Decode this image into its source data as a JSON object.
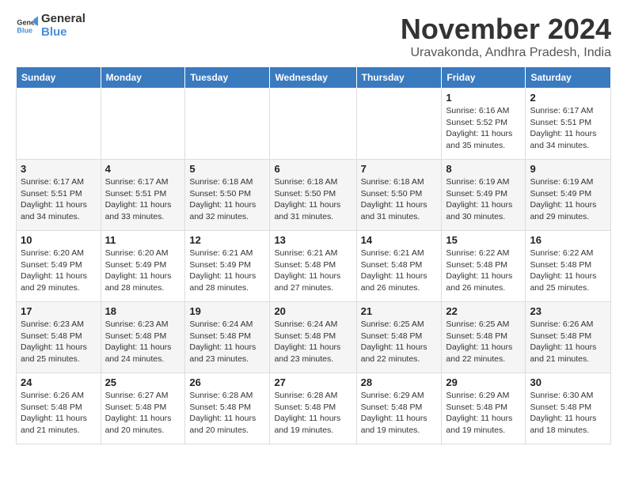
{
  "logo": {
    "text_general": "General",
    "text_blue": "Blue"
  },
  "header": {
    "month_title": "November 2024",
    "location": "Uravakonda, Andhra Pradesh, India"
  },
  "weekdays": [
    "Sunday",
    "Monday",
    "Tuesday",
    "Wednesday",
    "Thursday",
    "Friday",
    "Saturday"
  ],
  "weeks": [
    [
      {
        "day": "",
        "info": ""
      },
      {
        "day": "",
        "info": ""
      },
      {
        "day": "",
        "info": ""
      },
      {
        "day": "",
        "info": ""
      },
      {
        "day": "",
        "info": ""
      },
      {
        "day": "1",
        "info": "Sunrise: 6:16 AM\nSunset: 5:52 PM\nDaylight: 11 hours and 35 minutes."
      },
      {
        "day": "2",
        "info": "Sunrise: 6:17 AM\nSunset: 5:51 PM\nDaylight: 11 hours and 34 minutes."
      }
    ],
    [
      {
        "day": "3",
        "info": "Sunrise: 6:17 AM\nSunset: 5:51 PM\nDaylight: 11 hours and 34 minutes."
      },
      {
        "day": "4",
        "info": "Sunrise: 6:17 AM\nSunset: 5:51 PM\nDaylight: 11 hours and 33 minutes."
      },
      {
        "day": "5",
        "info": "Sunrise: 6:18 AM\nSunset: 5:50 PM\nDaylight: 11 hours and 32 minutes."
      },
      {
        "day": "6",
        "info": "Sunrise: 6:18 AM\nSunset: 5:50 PM\nDaylight: 11 hours and 31 minutes."
      },
      {
        "day": "7",
        "info": "Sunrise: 6:18 AM\nSunset: 5:50 PM\nDaylight: 11 hours and 31 minutes."
      },
      {
        "day": "8",
        "info": "Sunrise: 6:19 AM\nSunset: 5:49 PM\nDaylight: 11 hours and 30 minutes."
      },
      {
        "day": "9",
        "info": "Sunrise: 6:19 AM\nSunset: 5:49 PM\nDaylight: 11 hours and 29 minutes."
      }
    ],
    [
      {
        "day": "10",
        "info": "Sunrise: 6:20 AM\nSunset: 5:49 PM\nDaylight: 11 hours and 29 minutes."
      },
      {
        "day": "11",
        "info": "Sunrise: 6:20 AM\nSunset: 5:49 PM\nDaylight: 11 hours and 28 minutes."
      },
      {
        "day": "12",
        "info": "Sunrise: 6:21 AM\nSunset: 5:49 PM\nDaylight: 11 hours and 28 minutes."
      },
      {
        "day": "13",
        "info": "Sunrise: 6:21 AM\nSunset: 5:48 PM\nDaylight: 11 hours and 27 minutes."
      },
      {
        "day": "14",
        "info": "Sunrise: 6:21 AM\nSunset: 5:48 PM\nDaylight: 11 hours and 26 minutes."
      },
      {
        "day": "15",
        "info": "Sunrise: 6:22 AM\nSunset: 5:48 PM\nDaylight: 11 hours and 26 minutes."
      },
      {
        "day": "16",
        "info": "Sunrise: 6:22 AM\nSunset: 5:48 PM\nDaylight: 11 hours and 25 minutes."
      }
    ],
    [
      {
        "day": "17",
        "info": "Sunrise: 6:23 AM\nSunset: 5:48 PM\nDaylight: 11 hours and 25 minutes."
      },
      {
        "day": "18",
        "info": "Sunrise: 6:23 AM\nSunset: 5:48 PM\nDaylight: 11 hours and 24 minutes."
      },
      {
        "day": "19",
        "info": "Sunrise: 6:24 AM\nSunset: 5:48 PM\nDaylight: 11 hours and 23 minutes."
      },
      {
        "day": "20",
        "info": "Sunrise: 6:24 AM\nSunset: 5:48 PM\nDaylight: 11 hours and 23 minutes."
      },
      {
        "day": "21",
        "info": "Sunrise: 6:25 AM\nSunset: 5:48 PM\nDaylight: 11 hours and 22 minutes."
      },
      {
        "day": "22",
        "info": "Sunrise: 6:25 AM\nSunset: 5:48 PM\nDaylight: 11 hours and 22 minutes."
      },
      {
        "day": "23",
        "info": "Sunrise: 6:26 AM\nSunset: 5:48 PM\nDaylight: 11 hours and 21 minutes."
      }
    ],
    [
      {
        "day": "24",
        "info": "Sunrise: 6:26 AM\nSunset: 5:48 PM\nDaylight: 11 hours and 21 minutes."
      },
      {
        "day": "25",
        "info": "Sunrise: 6:27 AM\nSunset: 5:48 PM\nDaylight: 11 hours and 20 minutes."
      },
      {
        "day": "26",
        "info": "Sunrise: 6:28 AM\nSunset: 5:48 PM\nDaylight: 11 hours and 20 minutes."
      },
      {
        "day": "27",
        "info": "Sunrise: 6:28 AM\nSunset: 5:48 PM\nDaylight: 11 hours and 19 minutes."
      },
      {
        "day": "28",
        "info": "Sunrise: 6:29 AM\nSunset: 5:48 PM\nDaylight: 11 hours and 19 minutes."
      },
      {
        "day": "29",
        "info": "Sunrise: 6:29 AM\nSunset: 5:48 PM\nDaylight: 11 hours and 19 minutes."
      },
      {
        "day": "30",
        "info": "Sunrise: 6:30 AM\nSunset: 5:48 PM\nDaylight: 11 hours and 18 minutes."
      }
    ]
  ]
}
